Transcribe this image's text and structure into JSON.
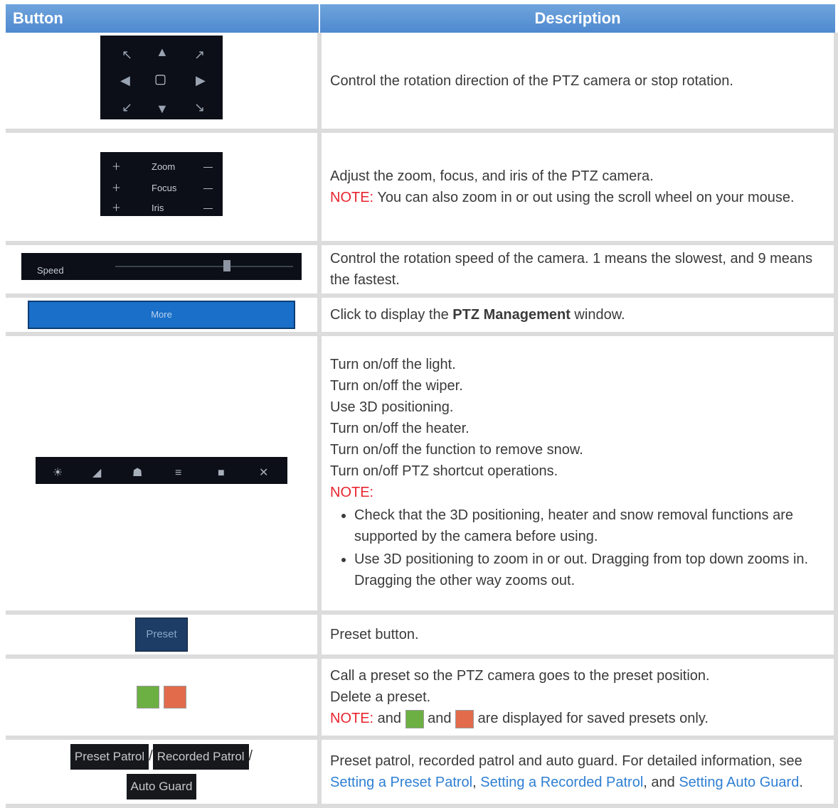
{
  "header": {
    "col_button": "Button",
    "col_description": "Description"
  },
  "rows": {
    "direction": {
      "text": "Control the rotation direction of the PTZ camera or stop rotation."
    },
    "lens": {
      "labels": [
        "Zoom",
        "Focus",
        "Iris"
      ],
      "text": "Adjust the zoom, focus, and iris of the PTZ camera.",
      "note_label": "NOTE:",
      "note_text": " You can also zoom in or out using the scroll wheel on your mouse."
    },
    "speed": {
      "label": "Speed",
      "text": "Control the rotation speed of the camera. 1 means the slowest, and 9 means the fastest."
    },
    "more": {
      "button_label": "More",
      "text_before": "Click to display the ",
      "text_bold": "PTZ Management",
      "text_after": " window."
    },
    "functions": {
      "lines": [
        "Turn on/off the light.",
        "Turn on/off the wiper.",
        "Use 3D positioning.",
        "Turn on/off the heater.",
        "Turn on/off the function to remove snow.",
        "Turn on/off PTZ shortcut operations."
      ],
      "note_label": "NOTE:",
      "bullets": [
        "Check that the 3D positioning, heater and snow removal functions are supported by the camera before using.",
        "Use 3D positioning to zoom in or out. Dragging from top down zooms in. Dragging the other way zooms out."
      ]
    },
    "preset": {
      "button_label": "Preset",
      "text": "Preset button."
    },
    "call_delete": {
      "line1": "Call a preset so the PTZ camera goes to the preset position.",
      "line2": "Delete a preset.",
      "note_label": "NOTE:",
      "note_and": " and ",
      "note_after": " are displayed for saved presets only."
    },
    "patrol": {
      "btn1": "Preset Patrol",
      "btn2": "Recorded Patrol",
      "btn3": "Auto Guard",
      "sep": "/",
      "text_before": "Preset patrol, recorded patrol and auto guard. For detailed information, see ",
      "link1": "Setting a Preset Patrol",
      "comma": ", ",
      "link2": "Setting a Recorded Patrol",
      "and_text": ", and ",
      "link3": "Setting Auto Guard",
      "period": "."
    }
  },
  "colors": {
    "header_blue": "#5b93d6",
    "note_red": "#e8242e",
    "link_blue": "#2f7fd3",
    "grid_gray": "#dcdcdc"
  }
}
